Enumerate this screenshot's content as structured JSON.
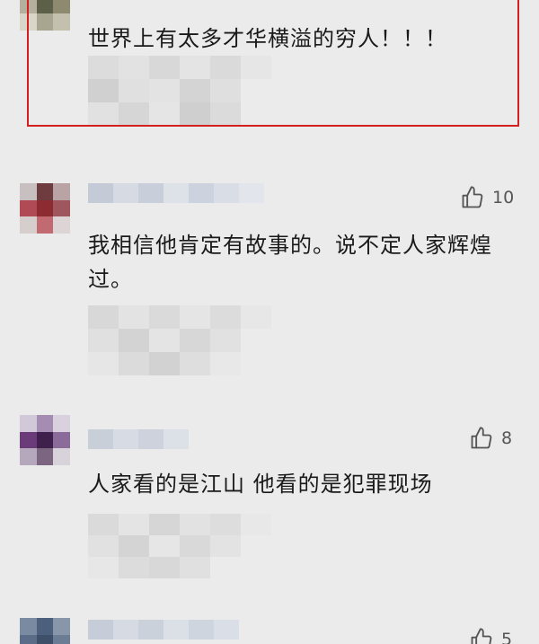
{
  "comments": [
    {
      "text": "世界上有太多才华横溢的穷人！！！",
      "likes": ""
    },
    {
      "text": "我相信他肯定有故事的。说不定人家辉煌过。",
      "likes": "10"
    },
    {
      "text": "人家看的是江山 他看的是犯罪现场",
      "likes": "8"
    },
    {
      "text": "",
      "likes": "5"
    }
  ],
  "colors": {
    "highlight_border": "#d21f1f",
    "background": "#ebebeb"
  },
  "icons": {
    "like": "thumbs-up-icon"
  }
}
